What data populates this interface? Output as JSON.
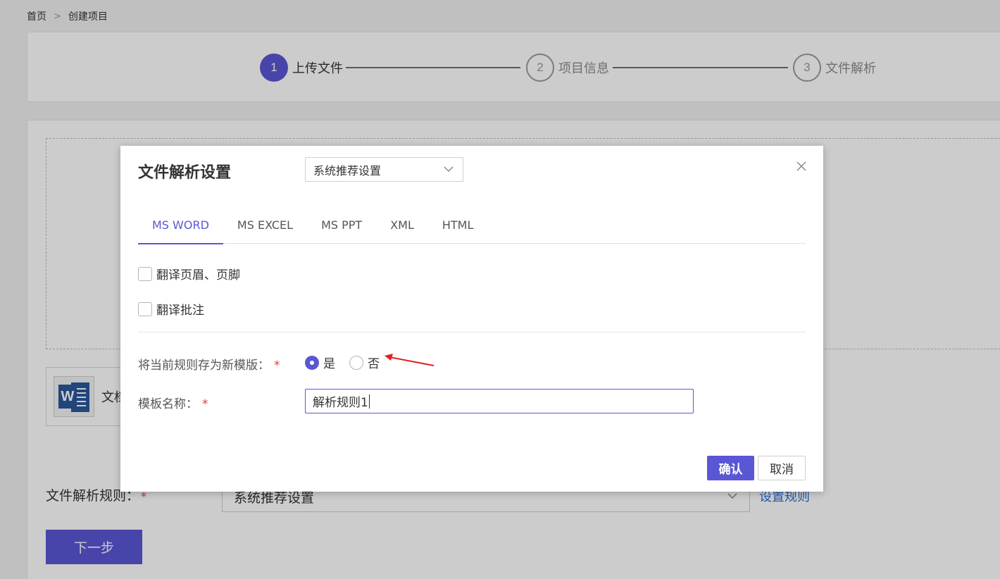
{
  "breadcrumb": {
    "home": "首页",
    "current": "创建项目",
    "separator": ">"
  },
  "steps": [
    {
      "number": "1",
      "label": "上传文件",
      "state": "active"
    },
    {
      "number": "2",
      "label": "项目信息",
      "state": "inactive"
    },
    {
      "number": "3",
      "label": "文件解析",
      "state": "inactive"
    }
  ],
  "background_form": {
    "file_name_partial": "文档",
    "rule_label": "文件解析规则：",
    "rule_required": "*",
    "rule_select_value": "系统推荐设置",
    "rule_link": "设置规则",
    "next_button": "下一步"
  },
  "modal": {
    "title": "文件解析设置",
    "preset_select_value": "系统推荐设置",
    "tabs": [
      {
        "label": "MS WORD",
        "active": true
      },
      {
        "label": "MS EXCEL",
        "active": false
      },
      {
        "label": "MS PPT",
        "active": false
      },
      {
        "label": "XML",
        "active": false
      },
      {
        "label": "HTML",
        "active": false
      }
    ],
    "options": [
      {
        "label": "翻译页眉、页脚",
        "checked": false
      },
      {
        "label": "翻译批注",
        "checked": false
      }
    ],
    "save_template_label": "将当前规则存为新模版：",
    "save_template_required": "*",
    "radio_options": [
      {
        "label": "是",
        "checked": true
      },
      {
        "label": "否",
        "checked": false
      }
    ],
    "template_name_label": "模板名称：",
    "template_name_required": "*",
    "template_name_value": "解析规则1",
    "confirm_button": "确认",
    "cancel_button": "取消"
  },
  "colors": {
    "accent": "#5a57d5",
    "required": "#e63b3b",
    "link": "#2f6fd6",
    "arrow": "#e02020"
  },
  "icons": {
    "close": "close-icon",
    "dropdown": "chevron-down-icon",
    "file": "word-file-icon",
    "annotation": "red-arrow-icon"
  }
}
